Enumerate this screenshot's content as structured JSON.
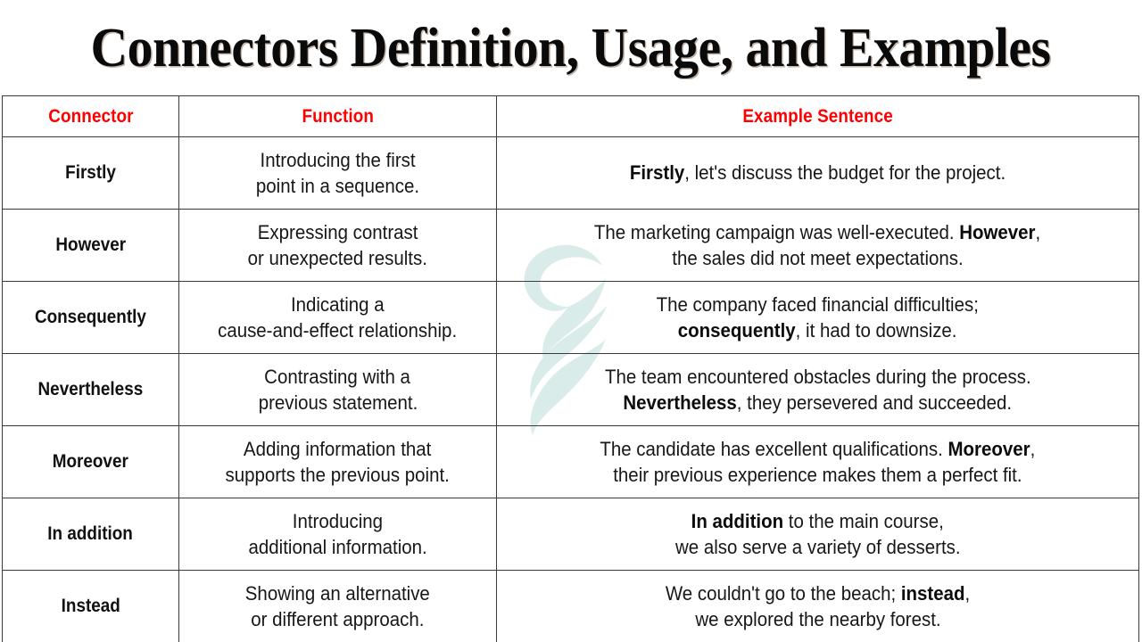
{
  "page": {
    "title": "Connectors Definition, Usage, and Examples",
    "background_color": "#ffffff",
    "title_color": "#0a0a0a",
    "header_text_color": "#ff0000",
    "border_color": "#3a3a3a",
    "watermark_color": "#d9ecea",
    "watermark_name": "stylized-figure-swoosh-logo"
  },
  "table": {
    "headers": {
      "connector": "Connector",
      "function": "Function",
      "example": "Example Sentence"
    },
    "rows": [
      {
        "connector": "Firstly",
        "function_line1": "Introducing the first",
        "function_line2": "point in a sequence.",
        "example_line1_bold": "Firstly",
        "example_line1_rest": ", let's discuss the budget for the project.",
        "example_line2_bold": "",
        "example_line2_rest": ""
      },
      {
        "connector": "However",
        "function_line1": "Expressing contrast",
        "function_line2": "or unexpected results.",
        "example_line1_pre": "The marketing campaign was well-executed. ",
        "example_line1_bold": "However",
        "example_line1_rest": ",",
        "example_line2_rest": "the sales did not meet expectations."
      },
      {
        "connector": "Consequently",
        "function_line1": "Indicating a",
        "function_line2": "cause-and-effect relationship.",
        "example_line1_rest": "The company faced financial difficulties;",
        "example_line2_bold": "consequently",
        "example_line2_rest": ", it had to downsize."
      },
      {
        "connector": "Nevertheless",
        "function_line1": "Contrasting with a",
        "function_line2": "previous statement.",
        "example_line1_rest": "The team encountered obstacles during the process.",
        "example_line2_bold": "Nevertheless",
        "example_line2_rest": ", they persevered and succeeded."
      },
      {
        "connector": "Moreover",
        "function_line1": "Adding information that",
        "function_line2": "supports the previous point.",
        "example_line1_pre": "The candidate has excellent qualifications. ",
        "example_line1_bold": "Moreover",
        "example_line1_rest": ",",
        "example_line2_rest": "their previous experience makes them a perfect fit."
      },
      {
        "connector": "In addition",
        "function_line1": "Introducing",
        "function_line2": "additional information.",
        "example_line1_bold": "In addition",
        "example_line1_rest": " to the main course,",
        "example_line2_rest": "we also serve a variety of desserts."
      },
      {
        "connector": "Instead",
        "function_line1": "Showing an alternative",
        "function_line2": "or different approach.",
        "example_line1_pre": "We couldn't go to the beach; ",
        "example_line1_bold": "instead",
        "example_line1_rest": ",",
        "example_line2_rest": "we explored the nearby forest."
      }
    ]
  }
}
